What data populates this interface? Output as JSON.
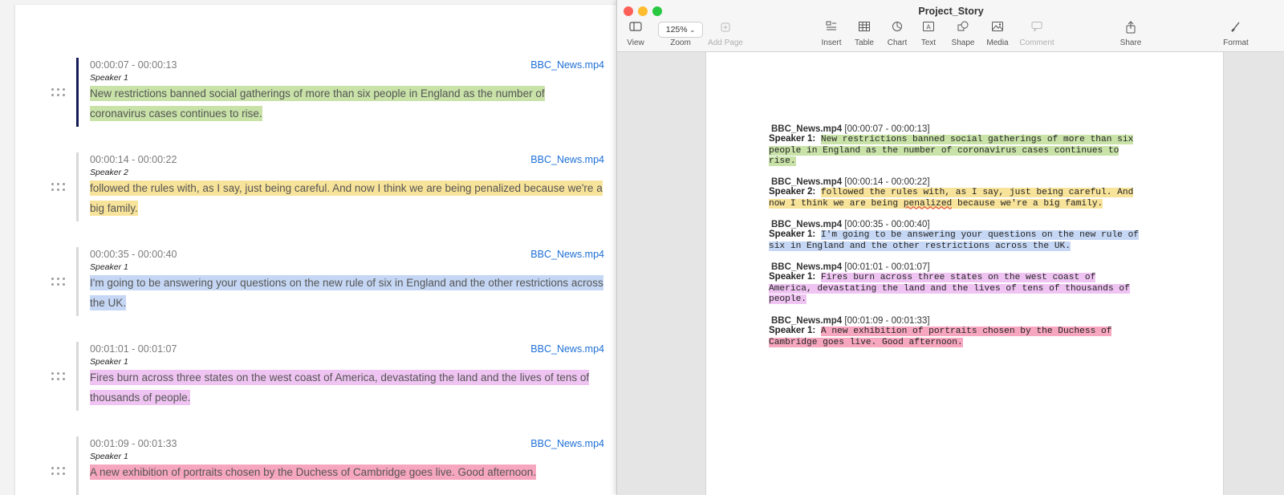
{
  "colors": {
    "green": "#c8e2a8",
    "yellow": "#f8e39a",
    "blue": "#c5d7f4",
    "pink": "#efc4f2",
    "red": "#f6a6be"
  },
  "transcript": {
    "segments": [
      {
        "time": "00:00:07 - 00:00:13",
        "file": "BBC_News.mp4",
        "speaker": "Speaker 1",
        "text": "New restrictions banned social gatherings of more than six people in England as the number of coronavirus cases continues to rise."
      },
      {
        "time": "00:00:14 - 00:00:22",
        "file": "BBC_News.mp4",
        "speaker": "Speaker 2",
        "text": "followed the rules with, as I say, just being careful. And now I think we are being penalized because we're a big family."
      },
      {
        "time": "00:00:35 - 00:00:40",
        "file": "BBC_News.mp4",
        "speaker": "Speaker 1",
        "text": "I'm going to be answering your questions on the new rule of six in England and the other restrictions across the UK."
      },
      {
        "time": "00:01:01 - 00:01:07",
        "file": "BBC_News.mp4",
        "speaker": "Speaker 1",
        "text": "Fires burn across three states on the west coast of America, devastating the land and the lives of tens of thousands of people."
      },
      {
        "time": "00:01:09 - 00:01:33",
        "file": "BBC_News.mp4",
        "speaker": "Speaker 1",
        "text": "A new exhibition of portraits chosen by the Duchess of Cambridge goes live. Good afternoon."
      }
    ]
  },
  "pages_window": {
    "title": "Project_Story",
    "zoom": "125%",
    "toolbar": {
      "view": "View",
      "zoom": "Zoom",
      "add_page": "Add Page",
      "insert": "Insert",
      "table": "Table",
      "chart": "Chart",
      "text": "Text",
      "shape": "Shape",
      "media": "Media",
      "comment": "Comment",
      "share": "Share",
      "format": "Format"
    },
    "document": [
      {
        "file": "BBC_News.mp4",
        "time": "[00:00:07 - 00:00:13]",
        "speaker": "Speaker 1:",
        "lines": [
          "New restrictions banned social gatherings of more than six",
          "people in England as the number of coronavirus cases continues to",
          "rise."
        ]
      },
      {
        "file": "BBC_News.mp4",
        "time": "[00:00:14 - 00:00:22]",
        "speaker": "Speaker 2:",
        "lines": [
          "followed the rules with, as I say, just being careful. And",
          "now I think we are being ",
          "penalized",
          " because we're a big family."
        ]
      },
      {
        "file": "BBC_News.mp4",
        "time": "[00:00:35 - 00:00:40]",
        "speaker": "Speaker 1:",
        "lines": [
          "I'm going to be answering your questions on the new rule of",
          "six in England and the other restrictions across the UK."
        ]
      },
      {
        "file": "BBC_News.mp4",
        "time": "[00:01:01 - 00:01:07]",
        "speaker": "Speaker 1:",
        "lines": [
          "Fires burn across three states on the west coast of",
          "America, devastating the land and the lives of tens of thousands of",
          "people."
        ]
      },
      {
        "file": "BBC_News.mp4",
        "time": "[00:01:09 - 00:01:33]",
        "speaker": "Speaker 1:",
        "lines": [
          "A new exhibition of portraits chosen by the Duchess of",
          "Cambridge goes live. Good afternoon."
        ]
      }
    ]
  }
}
